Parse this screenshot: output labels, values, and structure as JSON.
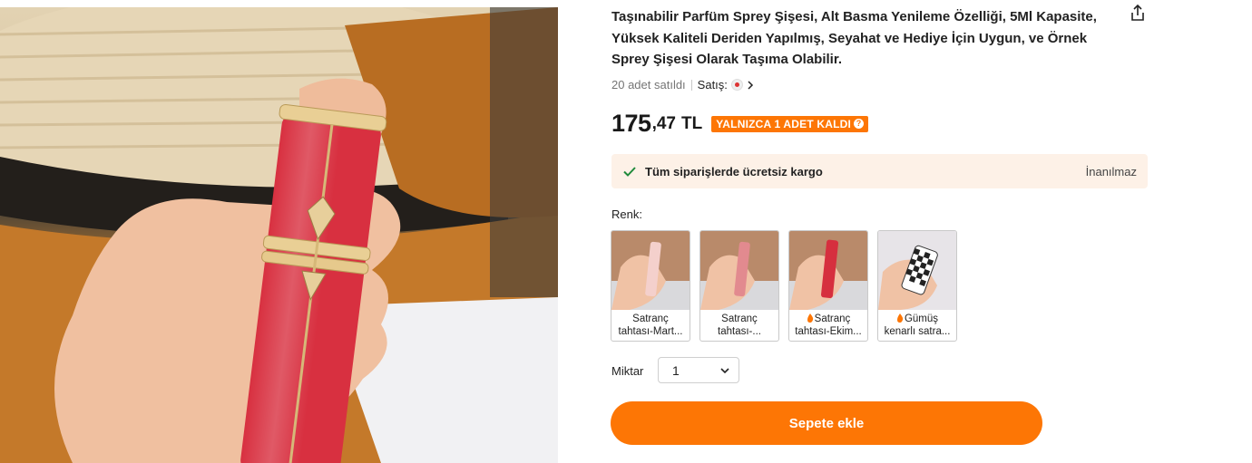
{
  "product": {
    "title": "Taşınabilir Parfüm Sprey Şişesi, Alt Basma Yenileme Özelliği, 5Ml Kapasite, Yüksek Kaliteli Deriden Yapılmış, Seyahat ve Hediye İçin Uygun, ve Örnek Sprey Şişesi Olarak Taşıma Olabilir.",
    "sold_count": "20 adet satıldı",
    "seller_label": "Satış:"
  },
  "price": {
    "integer": "175",
    "decimal": ",47",
    "currency": "TL",
    "stock_badge": "YALNIZCA 1 ADET KALDI"
  },
  "shipping": {
    "text": "Tüm siparişlerde ücretsiz kargo",
    "link": "İnanılmaz"
  },
  "color": {
    "label": "Renk:",
    "options": [
      {
        "name": "Satranç tahtası-Mart...",
        "line1": "Satranç",
        "line2": "tahtası-Mart...",
        "hot": false
      },
      {
        "name": "Satranç tahtası-...",
        "line1": "Satranç",
        "line2": "tahtası-...",
        "hot": false
      },
      {
        "name": "Satranç tahtası-Ekim...",
        "line1": "Satranç",
        "line2": "tahtası-Ekim...",
        "hot": true
      },
      {
        "name": "Gümüş kenarlı satra...",
        "line1": "Gümüş",
        "line2": "kenarlı satra...",
        "hot": true
      }
    ]
  },
  "quantity": {
    "label": "Miktar",
    "value": "1"
  },
  "cart": {
    "button_label": "Sepete ekle"
  },
  "icons": {
    "share": "share-icon",
    "check": "check-icon",
    "chevron": "chevron-down-icon",
    "flame": "flame-icon"
  },
  "colors": {
    "accent": "#fd7605",
    "shipping_bg": "#fdf1e7",
    "check": "#1f8a3b"
  }
}
